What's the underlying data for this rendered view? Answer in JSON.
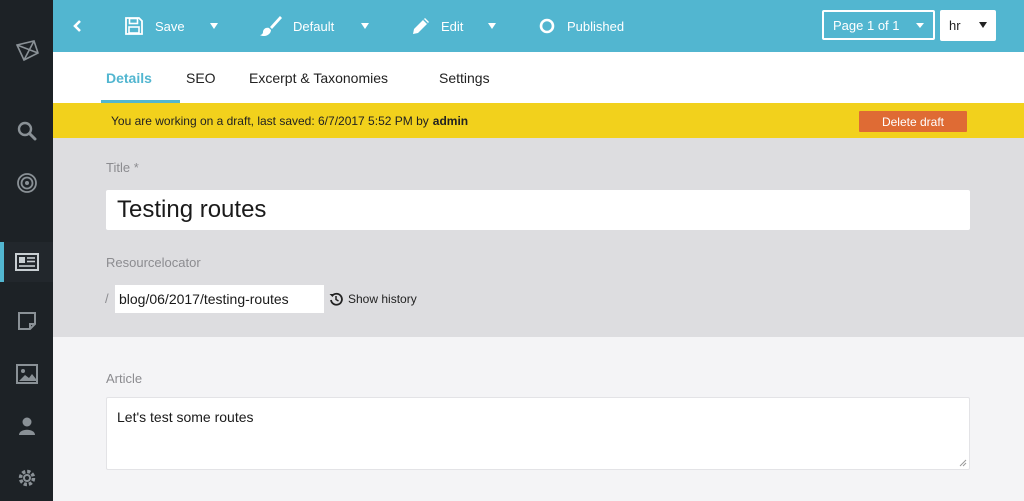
{
  "toolbar": {
    "save_label": "Save",
    "template_label": "Default",
    "edit_label": "Edit",
    "status_label": "Published",
    "page_select": "Page 1 of 1",
    "locale": "hr"
  },
  "tabs": [
    {
      "label": "Details",
      "active": true
    },
    {
      "label": "SEO",
      "active": false
    },
    {
      "label": "Excerpt & Taxonomies",
      "active": false
    },
    {
      "label": "Settings",
      "active": false
    }
  ],
  "banner": {
    "text": "You are working on a draft, last saved: 6/7/2017 5:52 PM by",
    "user": "admin",
    "delete_label": "Delete draft"
  },
  "form": {
    "title_label": "Title *",
    "title_value": "Testing routes",
    "resource_label": "Resourcelocator",
    "resource_prefix": "/",
    "resource_value": "blog/06/2017/testing-routes",
    "history_label": "Show history",
    "article_label": "Article",
    "article_value": "Let's test some routes"
  },
  "sidebar": {
    "icons": [
      "logo-icon",
      "search-icon",
      "target-icon",
      "pages-icon",
      "snippets-icon",
      "media-icon",
      "contacts-icon",
      "settings-icon"
    ]
  },
  "colors": {
    "accent": "#52b6d0",
    "sidebar": "#1d2226",
    "banner": "#f2d11c",
    "delete": "#df6b34",
    "section": "#dddde0"
  }
}
